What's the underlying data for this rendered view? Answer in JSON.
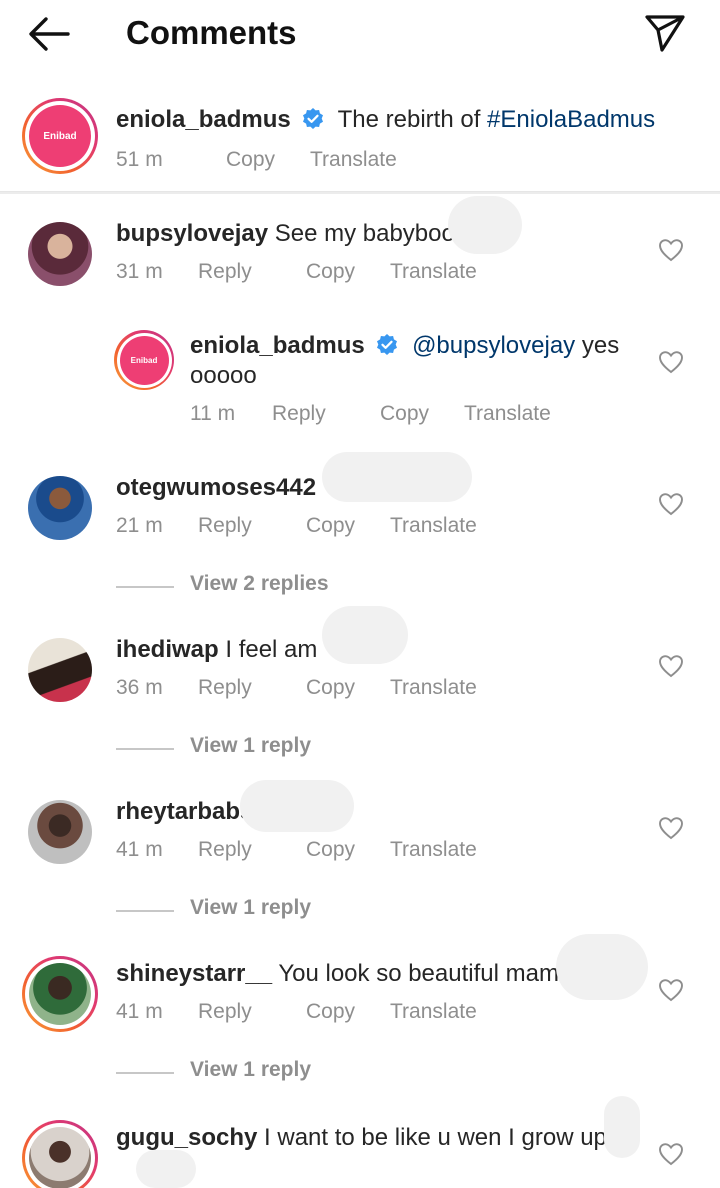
{
  "header": {
    "title": "Comments",
    "back_icon": "arrow-left-icon",
    "share_icon": "paper-plane-icon"
  },
  "caption": {
    "username": "eniola_badmus",
    "text": "The rebirth of ",
    "hashtag": "#EniolaBadmus",
    "time": "51 m",
    "copy": "Copy",
    "translate": "Translate",
    "avatar_logo_text": "Enibad"
  },
  "comments": [
    {
      "username": "bupsylovejay",
      "text": "See my babyboo",
      "time": "31 m",
      "reply": "Reply",
      "copy": "Copy",
      "translate": "Translate"
    },
    {
      "username": "eniola_badmus",
      "mention": "@bupsylovejay",
      "text": " yes",
      "text2": "ooooo",
      "time": "11 m",
      "reply": "Reply",
      "copy": "Copy",
      "translate": "Translate"
    },
    {
      "username": "otegwumoses442",
      "text": "",
      "time": "21 m",
      "reply": "Reply",
      "copy": "Copy",
      "translate": "Translate",
      "view_replies": "View 2 replies"
    },
    {
      "username": "ihediwap",
      "text": "I feel am",
      "time": "36 m",
      "reply": "Reply",
      "copy": "Copy",
      "translate": "Translate",
      "view_replies": "View 1 reply"
    },
    {
      "username": "rheytarbabs",
      "text": "",
      "time": "41 m",
      "reply": "Reply",
      "copy": "Copy",
      "translate": "Translate",
      "view_replies": "View 1 reply"
    },
    {
      "username": "shineystarr__",
      "text": "You look so beautiful mami",
      "time": "41 m",
      "reply": "Reply",
      "copy": "Copy",
      "translate": "Translate",
      "view_replies": "View 1 reply"
    },
    {
      "username": "gugu_sochy",
      "text": "I want to be like u wen I grow up",
      "time": "",
      "reply": "",
      "copy": "",
      "translate": ""
    }
  ],
  "colors": {
    "link": "#00376b",
    "verified": "#3897f0",
    "muted": "#8e8e8e",
    "brand_pink": "#ee3e74"
  }
}
